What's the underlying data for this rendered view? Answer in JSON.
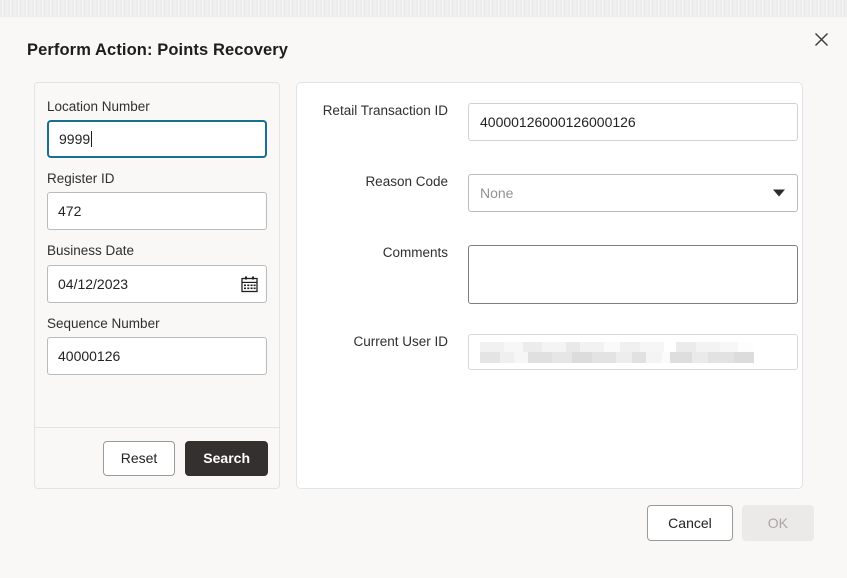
{
  "dialog": {
    "title": "Perform Action: Points Recovery",
    "close_icon": "close-icon"
  },
  "search_panel": {
    "fields": [
      {
        "label": "Location Number",
        "value": "9999",
        "focused": true
      },
      {
        "label": "Register ID",
        "value": "472",
        "focused": false
      },
      {
        "label": "Business Date",
        "value": "04/12/2023",
        "focused": false,
        "icon": "calendar-icon"
      },
      {
        "label": "Sequence Number",
        "value": "40000126",
        "focused": false
      }
    ],
    "reset_label": "Reset",
    "search_label": "Search"
  },
  "detail_panel": {
    "retail_transaction_id": {
      "label": "Retail Transaction ID",
      "value": "40000126000126000126"
    },
    "reason_code": {
      "label": "Reason Code",
      "value": "",
      "placeholder": "None",
      "icon": "chevron-down-icon"
    },
    "comments": {
      "label": "Comments",
      "value": "",
      "placeholder": ""
    },
    "current_user_id": {
      "label": "Current User ID",
      "value": "",
      "redacted": true
    }
  },
  "footer": {
    "cancel_label": "Cancel",
    "ok_label": "OK",
    "ok_disabled": true
  },
  "colors": {
    "page_background": "#f9f8f7",
    "card_border": "#dfe4e8",
    "focus_border": "#1a6e8e",
    "primary_button": "#33302e",
    "disabled_text": "#a9a6a3"
  }
}
